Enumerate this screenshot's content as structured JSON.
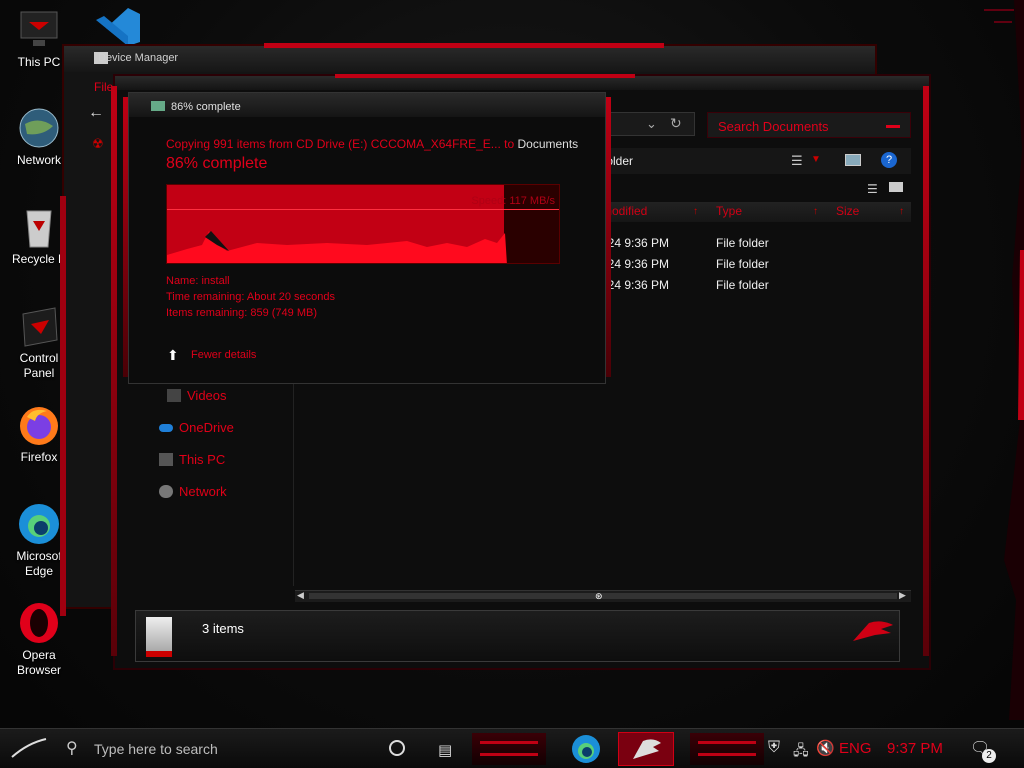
{
  "desktop": {
    "icons": [
      {
        "label": "This PC",
        "icon": "this-pc-icon"
      },
      {
        "label": "Network",
        "icon": "network-globe-icon"
      },
      {
        "label": "Recycle B",
        "icon": "recycle-bin-icon"
      },
      {
        "label": "Control Panel",
        "icon": "control-panel-icon"
      },
      {
        "label": "Firefox",
        "icon": "firefox-icon"
      },
      {
        "label": "Microsof Edge",
        "icon": "edge-icon"
      },
      {
        "label": "Opera Browser",
        "icon": "opera-icon"
      }
    ]
  },
  "device_manager": {
    "title": "Device Manager",
    "menu_first": "File"
  },
  "explorer": {
    "search_placeholder": "Search Documents",
    "toolbar_label": "folder",
    "columns": [
      "modified",
      "Type",
      "Size"
    ],
    "rows": [
      {
        "date": "024 9:36 PM",
        "type": "File folder"
      },
      {
        "date": "024 9:36 PM",
        "type": "File folder"
      },
      {
        "date": "024 9:36 PM",
        "type": "File folder"
      }
    ],
    "nav": [
      {
        "label": "Videos",
        "icon": "videos-icon"
      },
      {
        "label": "OneDrive",
        "icon": "onedrive-cloud-icon"
      },
      {
        "label": "This PC",
        "icon": "this-pc-icon"
      },
      {
        "label": "Network",
        "icon": "network-icon"
      }
    ],
    "status": "3 items"
  },
  "copy_dialog": {
    "title": "86% complete",
    "copying_prefix": "Copying 991 items from",
    "source": "CD Drive (E:) CCCOMA_X64FRE_E...",
    "to_word": "to",
    "destination": "Documents",
    "headline": "86% complete",
    "progress_fraction": 0.86,
    "speed": "Speed: 117 MB/s",
    "name_line": "Name: install",
    "time_line": "Time remaining: About 20 seconds",
    "items_line": "Items remaining: 859 (749 MB)",
    "fewer_details": "Fewer details"
  },
  "taskbar": {
    "search_placeholder": "Type here to search",
    "language": "ENG",
    "time": "9:37 PM",
    "notification_count": "2"
  },
  "colors": {
    "accent_red": "#e0001a",
    "background": "#0b0b0b"
  }
}
